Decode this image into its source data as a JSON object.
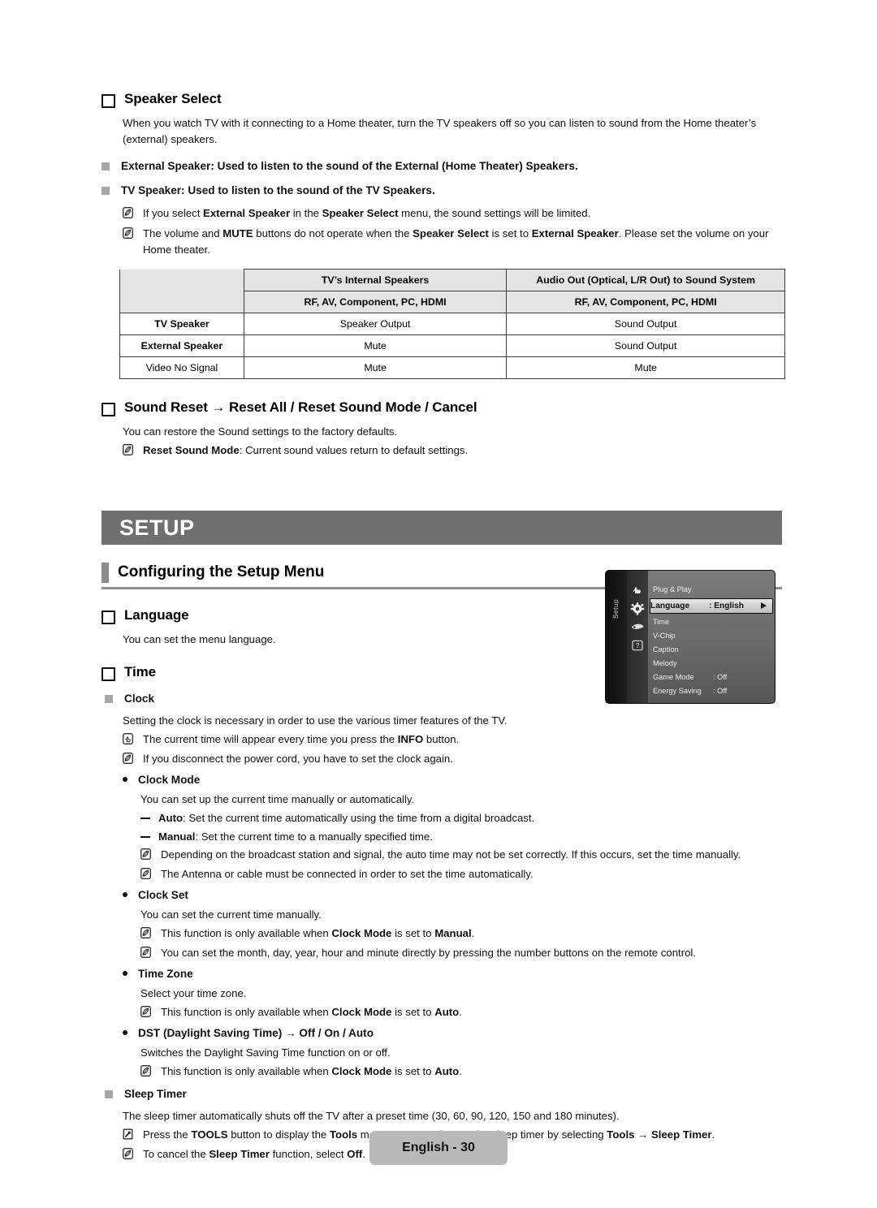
{
  "speaker_select": {
    "heading": "Speaker Select",
    "intro": "When you watch TV with it connecting to a Home theater, turn the TV speakers off so you can listen to sound from the Home theater’s (external) speakers.",
    "bullets": [
      "External Speaker: Used to listen to the sound of the External (Home Theater) Speakers.",
      "TV Speaker: Used to listen to the sound of the TV Speakers."
    ],
    "notes": [
      "If you select External Speaker in the Speaker Select menu, the sound settings will be limited.",
      "The volume and MUTE buttons do not operate when the Speaker Select is set to External Speaker. Please set the volume on your Home theater."
    ]
  },
  "speaker_table": {
    "header_row1": [
      "",
      "TV’s Internal Speakers",
      "Audio Out (Optical, L/R Out) to Sound System"
    ],
    "header_row2": [
      "",
      "RF, AV, Component, PC, HDMI",
      "RF, AV, Component, PC, HDMI"
    ],
    "rows": [
      {
        "label": "TV Speaker",
        "bold": true,
        "cells": [
          "Speaker Output",
          "Sound Output"
        ]
      },
      {
        "label": "External Speaker",
        "bold": true,
        "cells": [
          "Mute",
          "Sound Output"
        ]
      },
      {
        "label": "Video No Signal",
        "bold": false,
        "cells": [
          "Mute",
          "Mute"
        ]
      }
    ]
  },
  "sound_reset": {
    "heading": "Sound Reset → Reset All / Reset Sound Mode / Cancel",
    "intro": "You can restore the Sound settings to the factory defaults.",
    "note": "Reset Sound Mode: Current sound values return to default settings."
  },
  "setup_banner": "SETUP",
  "configuring": {
    "title": "Configuring the Setup Menu"
  },
  "language": {
    "heading": "Language",
    "text": "You can set the menu language."
  },
  "time": {
    "heading": "Time",
    "clock": {
      "label": "Clock",
      "intro": "Setting the clock is necessary in order to use the various timer features of the TV.",
      "notes": [
        "The current time will appear every time you press the INFO button.",
        "If you disconnect the power cord, you have to set the clock again."
      ]
    },
    "clock_mode": {
      "label": "Clock Mode",
      "intro": "You can set up the current time manually or automatically.",
      "dashes": [
        "Auto: Set the current time automatically using the time from a digital broadcast.",
        "Manual: Set the current time to a manually specified time."
      ],
      "notes": [
        "Depending on the broadcast station and signal, the auto time may not be set correctly. If this occurs, set the time manually.",
        "The Antenna or cable must be connected in order to set the time automatically."
      ]
    },
    "clock_set": {
      "label": "Clock Set",
      "intro": "You can set the current time manually.",
      "notes": [
        "This function is only available when Clock Mode is set to Manual.",
        "You can set the month, day, year, hour and minute directly by pressing the number buttons on the remote control."
      ]
    },
    "time_zone": {
      "label": "Time Zone",
      "intro": "Select your time zone.",
      "notes": [
        "This function is only available when Clock Mode is set to Auto."
      ]
    },
    "dst": {
      "label": "DST (Daylight Saving Time) → Off / On / Auto",
      "intro": "Switches the Daylight Saving Time function on or off.",
      "notes": [
        "This function is only available when Clock Mode is set to Auto."
      ]
    },
    "sleep_timer": {
      "label": "Sleep Timer",
      "intro": "The sleep timer automatically shuts off the TV after a preset time (30, 60, 90, 120, 150 and 180 minutes).",
      "tools_note": "Press the TOOLS button to display the Tools menu. You can also set the sleep timer by selecting Tools → Sleep Timer.",
      "note": "To cancel the Sleep Timer function, select Off."
    }
  },
  "tv_menu": {
    "sidebar_label": "Setup",
    "icons": [
      "hand-icon",
      "gear-icon",
      "speaker-icon",
      "help-icon"
    ],
    "items": [
      {
        "label": "Plug & Play",
        "value": "",
        "selected": false
      },
      {
        "label": "Language",
        "value": ": English",
        "selected": true
      },
      {
        "label": "Time",
        "value": "",
        "selected": false
      },
      {
        "label": "V-Chip",
        "value": "",
        "selected": false
      },
      {
        "label": "Caption",
        "value": "",
        "selected": false
      },
      {
        "label": "Melody",
        "value": "",
        "selected": false
      },
      {
        "label": "Game Mode",
        "value": ": Off",
        "selected": false
      },
      {
        "label": "Energy Saving",
        "value": ": Off",
        "selected": false
      }
    ]
  },
  "footer": {
    "page_label": "English - 30"
  },
  "colors": {
    "banner_gray": "#6f6f6f",
    "rule_gray": "#8e8e8e",
    "table_header": "#e4e4e4",
    "bullet_gray": "#a6a6a6",
    "footer_gray": "#b9b9b9"
  }
}
